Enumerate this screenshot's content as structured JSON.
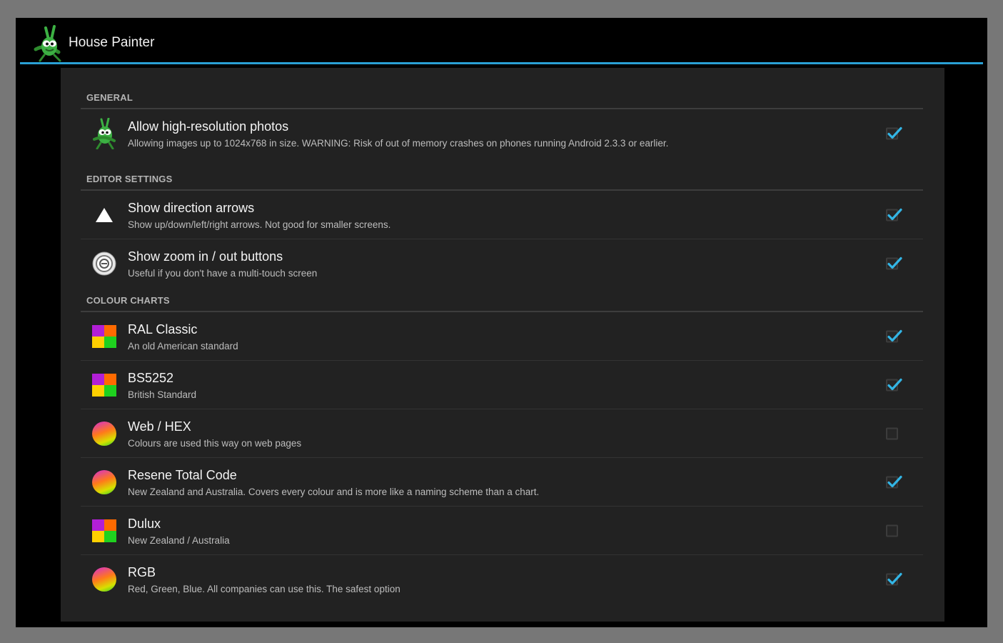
{
  "app": {
    "title": "House Painter",
    "icon": "grasshopper-icon"
  },
  "colors": {
    "accent": "#2aa0d5",
    "checkmark": "#33b5e5",
    "panel": "#222222"
  },
  "settings": {
    "general": {
      "label": "GENERAL",
      "items": [
        {
          "title": "Allow high-resolution photos",
          "summary": "Allowing images up to 1024x768 in size. WARNING: Risk of out of memory crashes on phones running Android 2.3.3 or earlier.",
          "icon": "grasshopper-icon",
          "checked": true
        }
      ]
    },
    "editor": {
      "label": "EDITOR SETTINGS",
      "items": [
        {
          "title": "Show direction arrows",
          "summary": "Show up/down/left/right arrows. Not good for smaller screens.",
          "icon": "arrow-up-icon",
          "checked": true
        },
        {
          "title": "Show zoom in / out buttons",
          "summary": "Useful if you don't have a multi-touch screen",
          "icon": "zoom-icon",
          "checked": true
        }
      ]
    },
    "charts": {
      "label": "COLOUR CHARTS",
      "items": [
        {
          "title": "RAL Classic",
          "summary": "An old American standard",
          "icon": "color-squares-icon",
          "checked": true
        },
        {
          "title": "BS5252",
          "summary": "British Standard",
          "icon": "color-squares-icon",
          "checked": true
        },
        {
          "title": "Web / HEX",
          "summary": "Colours are used this way on web pages",
          "icon": "color-ball-icon",
          "checked": false
        },
        {
          "title": "Resene Total Code",
          "summary": "New Zealand and Australia.  Covers every colour and is more like a naming scheme than a chart.",
          "icon": "color-ball-icon",
          "checked": true
        },
        {
          "title": "Dulux",
          "summary": "New Zealand / Australia",
          "icon": "color-squares-icon",
          "checked": false
        },
        {
          "title": "RGB",
          "summary": "Red, Green, Blue. All companies can use this. The safest option",
          "icon": "color-ball-icon",
          "checked": true
        }
      ]
    }
  }
}
